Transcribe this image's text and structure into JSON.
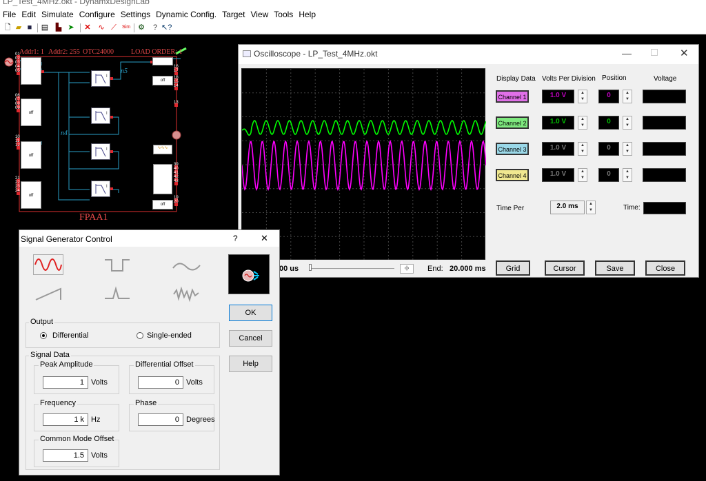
{
  "app": {
    "title": "LP_Test_4MHz.okt - DynamxDesignLab"
  },
  "menu": [
    "File",
    "Edit",
    "Simulate",
    "Configure",
    "Settings",
    "Dynamic Config.",
    "Target",
    "View",
    "Tools",
    "Help"
  ],
  "toolbar": {
    "sim_label": "Sim"
  },
  "fpaa": {
    "addr1": "Addr1: 1",
    "addr2": "Addr2: 255",
    "otc": "OTC24000",
    "load_order": "LOAD ORDER: 1",
    "name": "FPAA1",
    "net_n5": "n5",
    "net_n4": "n4",
    "off": "off",
    "cab_label": "I",
    "pins_left": [
      "01",
      "02",
      "03",
      "04",
      "05",
      "06",
      "07",
      "08",
      "09",
      "10",
      "11",
      "12",
      "21",
      "22",
      "23",
      "24"
    ],
    "pins_right": [
      "16",
      "17",
      "18",
      "15",
      "14",
      "13",
      "39",
      "40",
      "41",
      "42",
      "43",
      "19",
      "20"
    ]
  },
  "oscilloscope": {
    "title": "Oscilloscope - LP_Test_4MHz.okt",
    "headers": {
      "display": "Display Data",
      "vpd": "Volts Per Division",
      "position": "Position",
      "voltage": "Voltage"
    },
    "channels": [
      {
        "label": "Channel 1",
        "vpd": "1.0 V",
        "pos": "0",
        "color": "#e070e8",
        "text": "#c000c0"
      },
      {
        "label": "Channel 2",
        "vpd": "1.0 V",
        "pos": "0",
        "color": "#7ee87e",
        "text": "#00c000"
      },
      {
        "label": "Channel 3",
        "vpd": "1.0 V",
        "pos": "0",
        "color": "#9ad8e8",
        "text": "#606060"
      },
      {
        "label": "Channel 4",
        "vpd": "1.0 V",
        "pos": "0",
        "color": "#f0e890",
        "text": "#606060"
      }
    ],
    "time_per_label": "Time Per",
    "time_per_value": "2.0 ms",
    "time_label": "Time:",
    "start_value": "00 us",
    "end_label": "End:",
    "end_value": "20.000 ms",
    "buttons": {
      "grid": "Grid",
      "cursor": "Cursor",
      "save": "Save",
      "close": "Close"
    },
    "trace_colors": {
      "ch1": "#ff00ff",
      "ch2": "#00ff00"
    }
  },
  "siggen": {
    "title": "Signal Generator Control",
    "help_char": "?",
    "close_char": "✕",
    "output_label": "Output",
    "differential": "Differential",
    "single_ended": "Single-ended",
    "signal_data": "Signal Data",
    "peak_amplitude": {
      "label": "Peak Amplitude",
      "value": "1",
      "unit": "Volts"
    },
    "diff_offset": {
      "label": "Differential Offset",
      "value": "0",
      "unit": "Volts"
    },
    "frequency": {
      "label": "Frequency",
      "value": "1 k",
      "unit": "Hz"
    },
    "phase": {
      "label": "Phase",
      "value": "0",
      "unit": "Degrees"
    },
    "common_mode": {
      "label": "Common Mode Offset",
      "value": "1.5",
      "unit": "Volts"
    },
    "buttons": {
      "ok": "OK",
      "cancel": "Cancel",
      "help": "Help"
    }
  }
}
